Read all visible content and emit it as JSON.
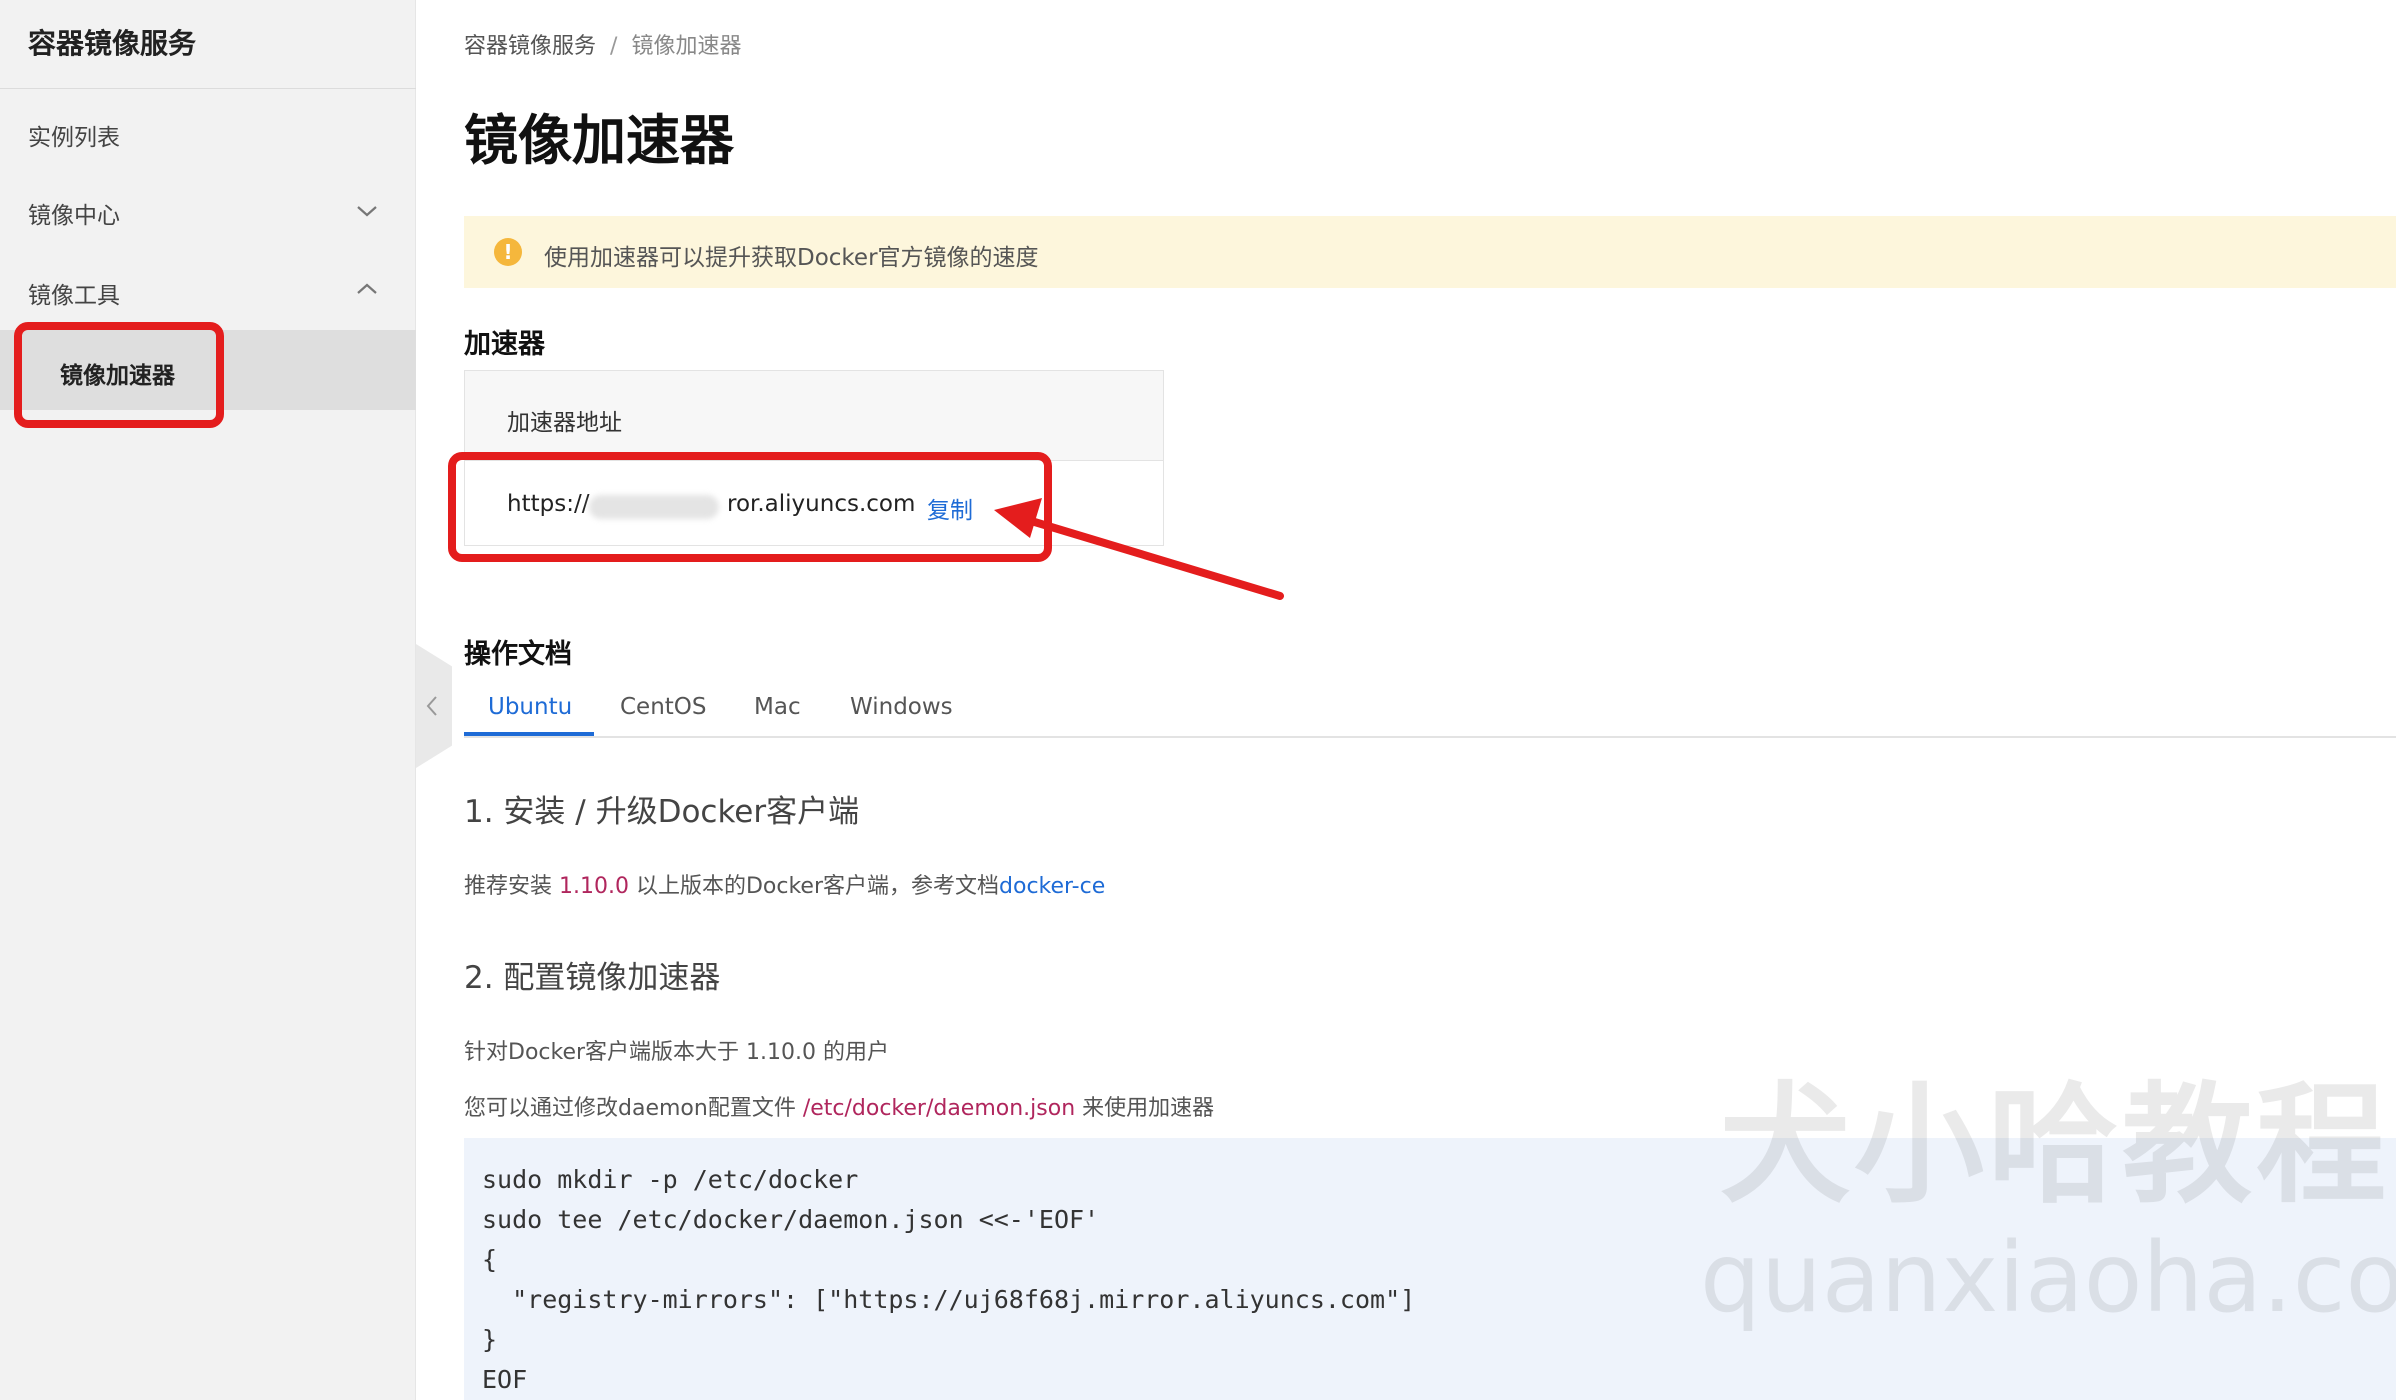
{
  "sidebar": {
    "title": "容器镜像服务",
    "items": [
      {
        "label": "实例列表"
      },
      {
        "label": "镜像中心"
      },
      {
        "label": "镜像工具"
      },
      {
        "label": "镜像加速器"
      }
    ]
  },
  "breadcrumb": {
    "root": "容器镜像服务",
    "separator": "/",
    "current": "镜像加速器"
  },
  "page_title": "镜像加速器",
  "notice": {
    "icon": "!",
    "text": "使用加速器可以提升获取Docker官方镜像的速度"
  },
  "accelerator": {
    "heading": "加速器",
    "column_header": "加速器地址",
    "url_prefix": "https://",
    "url_suffix": "ror.aliyuncs.com",
    "copy_label": "复制"
  },
  "docs": {
    "heading": "操作文档",
    "tabs": [
      {
        "label": "Ubuntu",
        "active": true
      },
      {
        "label": "CentOS",
        "active": false
      },
      {
        "label": "Mac",
        "active": false
      },
      {
        "label": "Windows",
        "active": false
      }
    ],
    "step1": {
      "title": "1. 安装 / 升级Docker客户端",
      "text_a": "推荐安装 ",
      "version": "1.10.0",
      "text_b": " 以上版本的Docker客户端，参考文档",
      "link": "docker-ce"
    },
    "step2": {
      "title": "2. 配置镜像加速器",
      "line1": "针对Docker客户端版本大于 1.10.0 的用户",
      "line2_a": "您可以通过修改daemon配置文件 ",
      "path": "/etc/docker/daemon.json",
      "line2_b": " 来使用加速器"
    },
    "code": "sudo mkdir -p /etc/docker\nsudo tee /etc/docker/daemon.json <<-'EOF'\n{\n  \"registry-mirrors\": [\"https://uj68f68j.mirror.aliyuncs.com\"]\n}\nEOF"
  },
  "watermark": {
    "cn": "犬小哈教程",
    "en": "quanxiaoha.com"
  },
  "colors": {
    "accent": "#1e6bd6",
    "highlight": "#e41d1d",
    "notice_bg": "#fdf6dc",
    "code_bg": "#eef3fb"
  }
}
